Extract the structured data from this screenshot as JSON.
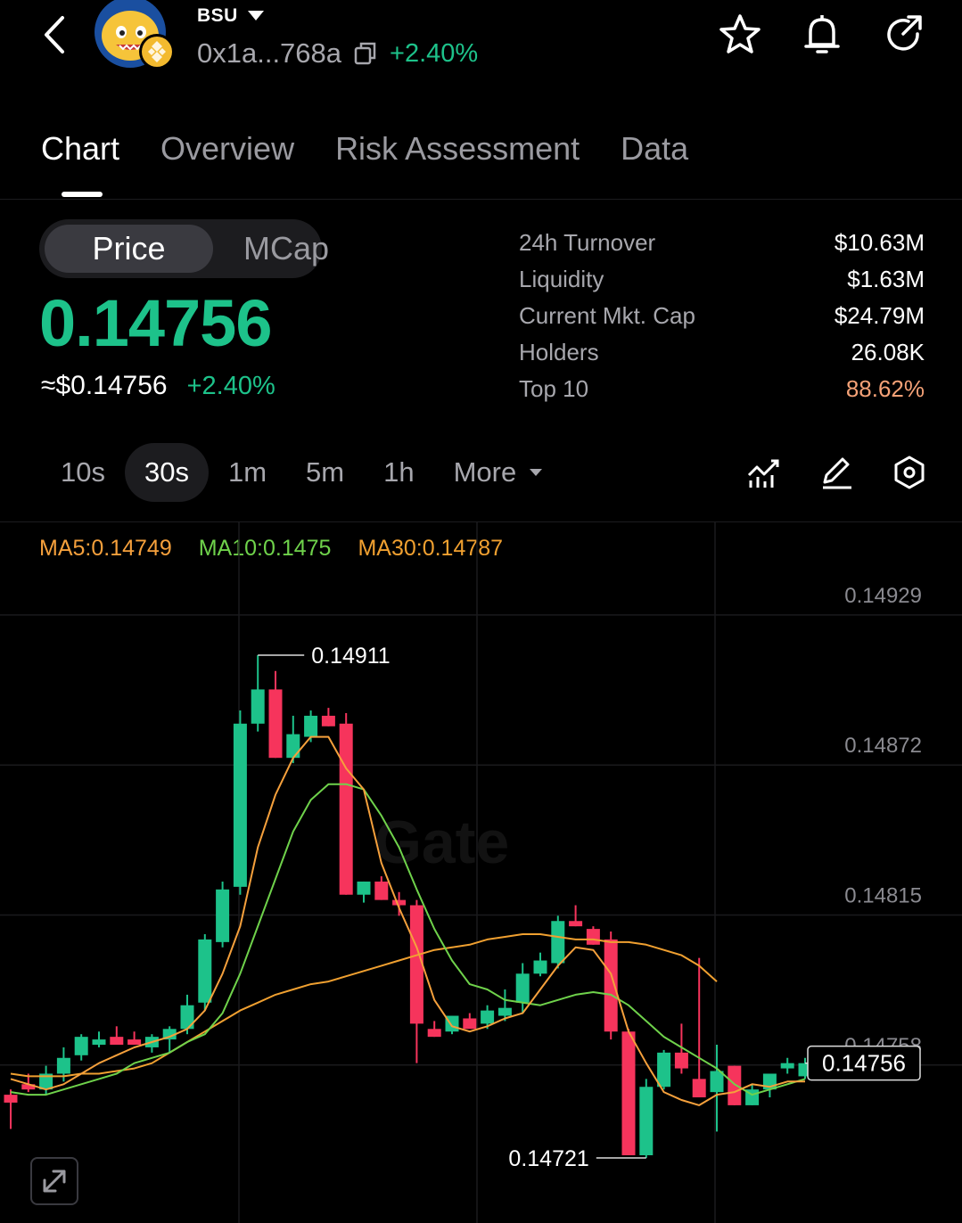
{
  "header": {
    "symbol": "BSU",
    "address": "0x1a...768a",
    "change": "+2.40%"
  },
  "tabs": [
    {
      "label": "Chart",
      "active": true
    },
    {
      "label": "Overview",
      "active": false
    },
    {
      "label": "Risk Assessment",
      "active": false
    },
    {
      "label": "Data",
      "active": false
    }
  ],
  "toggle": {
    "price": "Price",
    "mcap": "MCap"
  },
  "price": {
    "value": "0.14756",
    "usd": "≈$0.14756",
    "change": "+2.40%"
  },
  "stats": [
    {
      "label": "24h  Turnover",
      "value": "$10.63M"
    },
    {
      "label": "Liquidity",
      "value": "$1.63M"
    },
    {
      "label": "Current Mkt. Cap",
      "value": "$24.79M"
    },
    {
      "label": "Holders",
      "value": "26.08K"
    },
    {
      "label": "Top 10",
      "value": "88.62%"
    }
  ],
  "intervals": {
    "items": [
      "10s",
      "30s",
      "1m",
      "5m",
      "1h"
    ],
    "selected": "30s",
    "more": "More"
  },
  "colors": {
    "up": "#1dc28a",
    "down": "#f6345c",
    "ma5": "#f5a03c",
    "ma10": "#6fd24b",
    "ma30": "#f0a030",
    "background": "#000000"
  },
  "chart_data": {
    "type": "candlestick",
    "indicators": [
      {
        "name": "MA5",
        "label": "MA5:0.14749"
      },
      {
        "name": "MA10",
        "label": "MA10:0.1475"
      },
      {
        "name": "MA30",
        "label": "MA30:0.14787"
      }
    ],
    "y_ticks": [
      "0.14929",
      "0.14872",
      "0.14815",
      "0.14758"
    ],
    "y_range": [
      0.147,
      0.14952
    ],
    "watermark": "Gate",
    "current_price_label": "0.14756",
    "high_label": "0.14911",
    "low_label": "0.14721",
    "candles": [
      {
        "o": 0.14744,
        "h": 0.14746,
        "l": 0.14731,
        "c": 0.14741
      },
      {
        "o": 0.14748,
        "h": 0.14752,
        "l": 0.14745,
        "c": 0.14746
      },
      {
        "o": 0.14746,
        "h": 0.14755,
        "l": 0.14744,
        "c": 0.14752
      },
      {
        "o": 0.14752,
        "h": 0.14762,
        "l": 0.14749,
        "c": 0.14758
      },
      {
        "o": 0.14759,
        "h": 0.14767,
        "l": 0.14757,
        "c": 0.14766
      },
      {
        "o": 0.14763,
        "h": 0.14768,
        "l": 0.14762,
        "c": 0.14765
      },
      {
        "o": 0.14766,
        "h": 0.1477,
        "l": 0.14763,
        "c": 0.14763
      },
      {
        "o": 0.14765,
        "h": 0.14768,
        "l": 0.14763,
        "c": 0.14763
      },
      {
        "o": 0.14762,
        "h": 0.14767,
        "l": 0.1476,
        "c": 0.14766
      },
      {
        "o": 0.14765,
        "h": 0.1477,
        "l": 0.1476,
        "c": 0.14769
      },
      {
        "o": 0.14769,
        "h": 0.14782,
        "l": 0.14767,
        "c": 0.14778
      },
      {
        "o": 0.14779,
        "h": 0.14805,
        "l": 0.14776,
        "c": 0.14803
      },
      {
        "o": 0.14802,
        "h": 0.14825,
        "l": 0.148,
        "c": 0.14822
      },
      {
        "o": 0.14823,
        "h": 0.1489,
        "l": 0.1482,
        "c": 0.14885
      },
      {
        "o": 0.14885,
        "h": 0.14911,
        "l": 0.14882,
        "c": 0.14898
      },
      {
        "o": 0.14898,
        "h": 0.14905,
        "l": 0.14872,
        "c": 0.14872
      },
      {
        "o": 0.14872,
        "h": 0.14888,
        "l": 0.1487,
        "c": 0.14881
      },
      {
        "o": 0.1488,
        "h": 0.1489,
        "l": 0.14878,
        "c": 0.14888
      },
      {
        "o": 0.14888,
        "h": 0.14891,
        "l": 0.14884,
        "c": 0.14884
      },
      {
        "o": 0.14885,
        "h": 0.14889,
        "l": 0.1482,
        "c": 0.1482
      },
      {
        "o": 0.1482,
        "h": 0.14825,
        "l": 0.14817,
        "c": 0.14825
      },
      {
        "o": 0.14825,
        "h": 0.14827,
        "l": 0.14818,
        "c": 0.14818
      },
      {
        "o": 0.14818,
        "h": 0.14821,
        "l": 0.14812,
        "c": 0.14816
      },
      {
        "o": 0.14816,
        "h": 0.14818,
        "l": 0.14756,
        "c": 0.14771
      },
      {
        "o": 0.14769,
        "h": 0.14772,
        "l": 0.14766,
        "c": 0.14766
      },
      {
        "o": 0.14768,
        "h": 0.14774,
        "l": 0.14767,
        "c": 0.14774
      },
      {
        "o": 0.14773,
        "h": 0.14775,
        "l": 0.1477,
        "c": 0.14769
      },
      {
        "o": 0.14771,
        "h": 0.14778,
        "l": 0.14769,
        "c": 0.14776
      },
      {
        "o": 0.14774,
        "h": 0.14784,
        "l": 0.14772,
        "c": 0.14777
      },
      {
        "o": 0.14779,
        "h": 0.14794,
        "l": 0.14775,
        "c": 0.1479
      },
      {
        "o": 0.1479,
        "h": 0.14798,
        "l": 0.14789,
        "c": 0.14795
      },
      {
        "o": 0.14794,
        "h": 0.14812,
        "l": 0.14792,
        "c": 0.1481
      },
      {
        "o": 0.1481,
        "h": 0.14816,
        "l": 0.14808,
        "c": 0.14808
      },
      {
        "o": 0.14807,
        "h": 0.14808,
        "l": 0.14801,
        "c": 0.14801
      },
      {
        "o": 0.14803,
        "h": 0.14806,
        "l": 0.14765,
        "c": 0.14768
      },
      {
        "o": 0.14768,
        "h": 0.14769,
        "l": 0.14721,
        "c": 0.14721
      },
      {
        "o": 0.14721,
        "h": 0.1475,
        "l": 0.1472,
        "c": 0.14747
      },
      {
        "o": 0.14747,
        "h": 0.14761,
        "l": 0.14746,
        "c": 0.1476
      },
      {
        "o": 0.1476,
        "h": 0.14771,
        "l": 0.14752,
        "c": 0.14754
      },
      {
        "o": 0.1475,
        "h": 0.14796,
        "l": 0.14745,
        "c": 0.14743
      },
      {
        "o": 0.14745,
        "h": 0.14763,
        "l": 0.1473,
        "c": 0.14753
      },
      {
        "o": 0.14755,
        "h": 0.14755,
        "l": 0.1474,
        "c": 0.1474
      },
      {
        "o": 0.1474,
        "h": 0.14748,
        "l": 0.1474,
        "c": 0.14746
      },
      {
        "o": 0.14746,
        "h": 0.14751,
        "l": 0.14743,
        "c": 0.14752
      },
      {
        "o": 0.14754,
        "h": 0.14758,
        "l": 0.14752,
        "c": 0.14756
      },
      {
        "o": 0.14751,
        "h": 0.14758,
        "l": 0.1475,
        "c": 0.14756
      }
    ],
    "ma5": [
      0.1475,
      0.14748,
      0.14746,
      0.14748,
      0.14752,
      0.14756,
      0.14759,
      0.14762,
      0.14764,
      0.14766,
      0.14769,
      0.14776,
      0.1479,
      0.14808,
      0.14838,
      0.14858,
      0.14872,
      0.1488,
      0.1488,
      0.14868,
      0.1486,
      0.14832,
      0.14815,
      0.148,
      0.1478,
      0.1477,
      0.14768,
      0.1477,
      0.14773,
      0.14775,
      0.14784,
      0.14793,
      0.148,
      0.14799,
      0.1479,
      0.14768,
      0.14756,
      0.14745,
      0.14742,
      0.1474,
      0.14744,
      0.14745,
      0.14748,
      0.14747,
      0.14749,
      0.14749
    ],
    "ma10": [
      0.14745,
      0.14744,
      0.14744,
      0.14746,
      0.14748,
      0.1475,
      0.14752,
      0.14756,
      0.14758,
      0.1476,
      0.14764,
      0.14767,
      0.14775,
      0.1479,
      0.14808,
      0.14826,
      0.14844,
      0.14856,
      0.14862,
      0.14862,
      0.1486,
      0.1485,
      0.14838,
      0.14822,
      0.14807,
      0.14795,
      0.14786,
      0.14784,
      0.1478,
      0.14779,
      0.14778,
      0.1478,
      0.14782,
      0.14783,
      0.14782,
      0.14778,
      0.14772,
      0.14766,
      0.14762,
      0.14758,
      0.14754,
      0.14748,
      0.14744,
      0.14746,
      0.14748,
      0.1475
    ],
    "ma30": [
      0.14752,
      0.14751,
      0.14751,
      0.14751,
      0.14752,
      0.14752,
      0.14753,
      0.14754,
      0.14756,
      0.1476,
      0.14764,
      0.14768,
      0.14772,
      0.14776,
      0.14779,
      0.14782,
      0.14784,
      0.14786,
      0.14787,
      0.14789,
      0.14791,
      0.14793,
      0.14795,
      0.14797,
      0.14799,
      0.148,
      0.14801,
      0.14803,
      0.14804,
      0.14805,
      0.14805,
      0.14804,
      0.14803,
      0.14803,
      0.14802,
      0.14802,
      0.14801,
      0.14799,
      0.14797,
      0.14793,
      0.14787
    ]
  }
}
